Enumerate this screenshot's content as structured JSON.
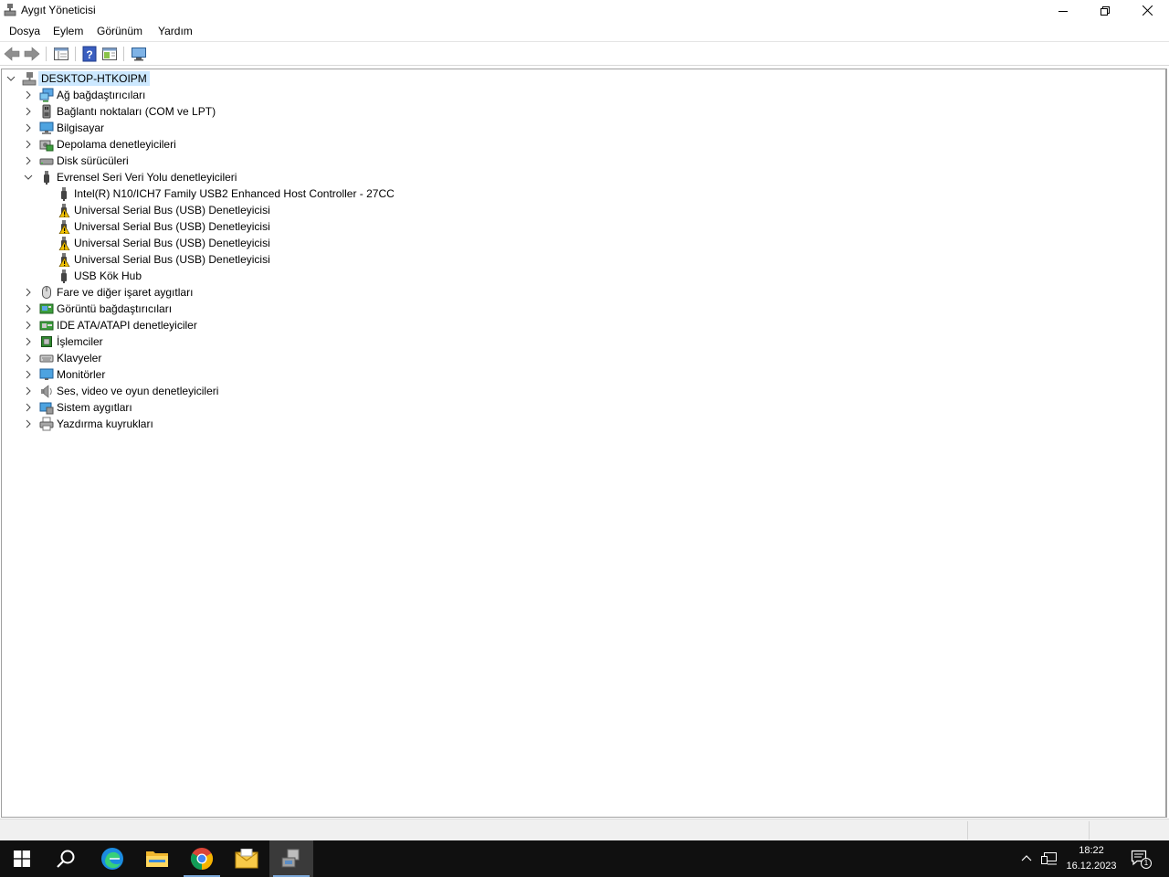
{
  "window": {
    "title": "Aygıt Yöneticisi"
  },
  "menu": {
    "items": [
      "Dosya",
      "Eylem",
      "Görünüm",
      "Yardım"
    ]
  },
  "tree": {
    "root": "DESKTOP-HTKOIPM",
    "categories": [
      {
        "label": "Ağ bağdaştırıcıları",
        "icon": "network-adapter-icon",
        "expanded": false
      },
      {
        "label": "Bağlantı noktaları (COM ve LPT)",
        "icon": "port-icon",
        "expanded": false
      },
      {
        "label": "Bilgisayar",
        "icon": "computer-icon",
        "expanded": false
      },
      {
        "label": "Depolama denetleyicileri",
        "icon": "storage-controller-icon",
        "expanded": false
      },
      {
        "label": "Disk sürücüleri",
        "icon": "disk-drive-icon",
        "expanded": false
      },
      {
        "label": "Evrensel Seri Veri Yolu denetleyicileri",
        "icon": "usb-icon",
        "expanded": true
      },
      {
        "label": "Fare ve diğer işaret aygıtları",
        "icon": "mouse-icon",
        "expanded": false
      },
      {
        "label": "Görüntü bağdaştırıcıları",
        "icon": "display-adapter-icon",
        "expanded": false
      },
      {
        "label": "IDE ATA/ATAPI denetleyiciler",
        "icon": "ide-controller-icon",
        "expanded": false
      },
      {
        "label": "İşlemciler",
        "icon": "processor-icon",
        "expanded": false
      },
      {
        "label": "Klavyeler",
        "icon": "keyboard-icon",
        "expanded": false
      },
      {
        "label": "Monitörler",
        "icon": "monitor-icon",
        "expanded": false
      },
      {
        "label": "Ses, video ve oyun denetleyicileri",
        "icon": "speaker-icon",
        "expanded": false
      },
      {
        "label": "Sistem aygıtları",
        "icon": "system-device-icon",
        "expanded": false
      },
      {
        "label": "Yazdırma kuyrukları",
        "icon": "printer-icon",
        "expanded": false
      }
    ],
    "usb_children": [
      {
        "label": "Intel(R) N10/ICH7 Family USB2 Enhanced Host Controller - 27CC",
        "warning": false
      },
      {
        "label": "Universal Serial Bus (USB) Denetleyicisi",
        "warning": true
      },
      {
        "label": "Universal Serial Bus (USB) Denetleyicisi",
        "warning": true
      },
      {
        "label": "Universal Serial Bus (USB) Denetleyicisi",
        "warning": true
      },
      {
        "label": "Universal Serial Bus (USB) Denetleyicisi",
        "warning": true
      },
      {
        "label": "USB Kök Hub",
        "warning": false
      }
    ]
  },
  "taskbar": {
    "apps": [
      "start-icon",
      "search-icon",
      "edge-icon",
      "file-explorer-icon",
      "chrome-icon",
      "mail-icon",
      "device-manager-icon"
    ],
    "time": "18:22",
    "date": "16.12.2023",
    "notification_count": "1"
  }
}
